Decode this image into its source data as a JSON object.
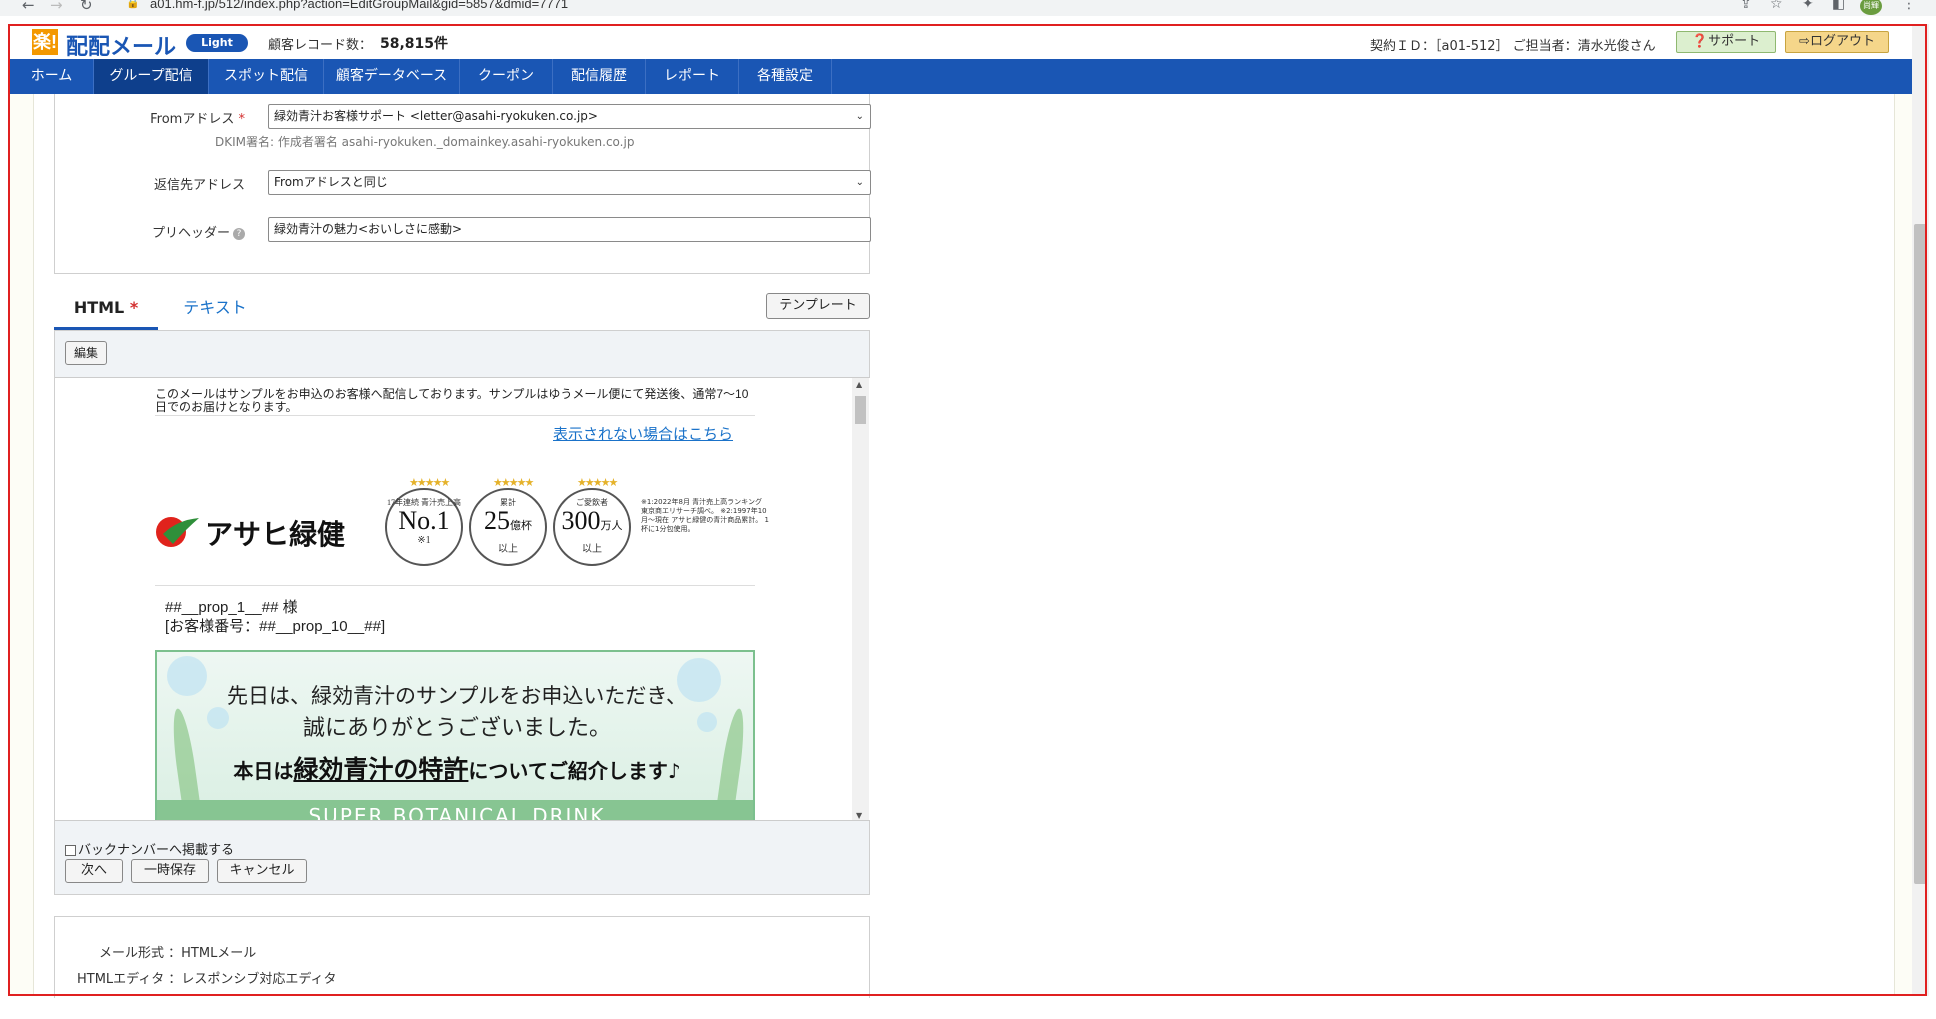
{
  "browser": {
    "url": "a01.hm-f.jp/512/index.php?action=EditGroupMail&gid=5857&dmid=7771",
    "profile_label": "尚輝"
  },
  "header": {
    "logo_mark": "楽!",
    "logo_text": "配配メール",
    "logo_badge": "Light",
    "record_label": "顧客レコード数：",
    "record_count": "58,815件",
    "contract_info": "契約ＩＤ：［a01-512］ ご担当者：清水光俊さん",
    "support_label": "サポート",
    "logout_label": "ログアウト"
  },
  "nav": {
    "items": [
      "ホーム",
      "グループ配信",
      "スポット配信",
      "顧客データベース",
      "クーポン",
      "配信履歴",
      "レポート",
      "各種設定"
    ],
    "active": "グループ配信"
  },
  "form": {
    "from_label": "Fromアドレス",
    "from_required": "*",
    "from_value": "緑効青汁お客様サポート <letter@asahi-ryokuken.co.jp>",
    "dkim_note": "DKIM署名: 作成者署名 asahi-ryokuken._domainkey.asahi-ryokuken.co.jp",
    "reply_label": "返信先アドレス",
    "reply_value": "Fromアドレスと同じ",
    "preheader_label": "プリヘッダー",
    "preheader_value": "緑効青汁の魅力<おいしさに感動>"
  },
  "tabs": {
    "html_label": "HTML",
    "html_required": "*",
    "text_label": "テキスト",
    "template_button": "テンプレート"
  },
  "editor": {
    "edit_button": "編集",
    "intro": "このメールはサンプルをお申込のお客様へ配信しております。サンプルはゆうメール便にて発送後、通常7〜10日でのお届けとなります。",
    "view_link": "表示されない場合はこちら",
    "brand_name": "アサヒ緑健",
    "medals": [
      {
        "top": "17年連続 青汁売上高",
        "big": "No.1",
        "bot": "※1"
      },
      {
        "top": "累計",
        "big": "25",
        "unit": "億杯",
        "bot": "以上"
      },
      {
        "top": "ご愛飲者",
        "big": "300",
        "unit": "万人",
        "bot": "以上"
      }
    ],
    "notes": "※1:2022年8月 青汁売上高ランキング 東京商エリサーチ調べ。 ※2:1997年10月〜現在 アサヒ緑健の青汁商品累計。 1杯に1分包使用。",
    "greeting_line1": "##__prop_1__## 様",
    "greeting_line2": "[お客様番号：##__prop_10__##]",
    "banner_line1": "先日は、緑効青汁のサンプルをお申込いただき、",
    "banner_line2": "誠にありがとうございました。",
    "banner_line3_pre": "本日は",
    "banner_line3_hl": "緑効青汁の特許",
    "banner_line3_post": "についてご紹介します♪",
    "banner_line4": "SUPER BOTANICAL DRINK",
    "backnumber_label": "バックナンバーへ掲載する",
    "next_button": "次へ",
    "save_button": "一時保存",
    "cancel_button": "キャンセル"
  },
  "info": {
    "format_label": "メール形式 ：HTMLメール",
    "editor_label": "HTMLエディタ ：レスポンシブ対応エディタ"
  },
  "colors": {
    "brand_blue": "#1a56b4",
    "frame_red": "#e02020",
    "link_blue": "#1a72c9"
  }
}
